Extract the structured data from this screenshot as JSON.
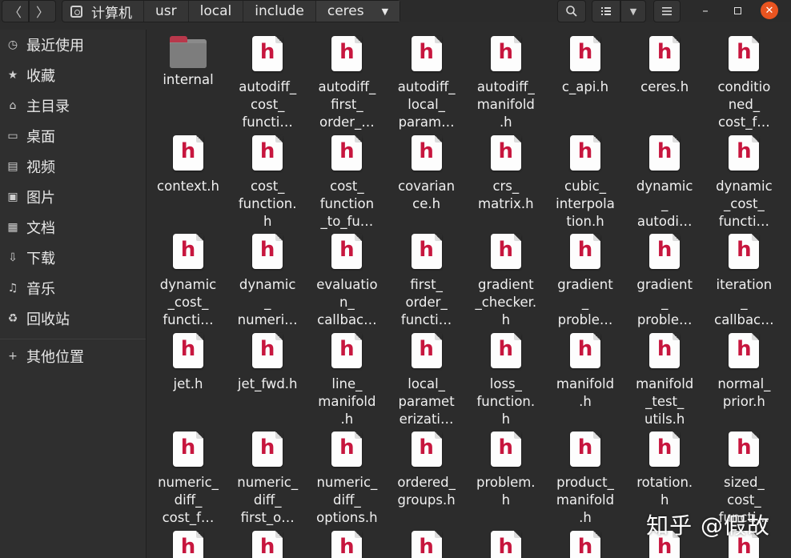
{
  "breadcrumbs": [
    "计算机",
    "usr",
    "local",
    "include",
    "ceres"
  ],
  "sidebar": {
    "items": [
      {
        "label": "最近使用",
        "icon": "clock-icon",
        "glyph": "◷"
      },
      {
        "label": "收藏",
        "icon": "star-icon",
        "glyph": "★"
      },
      {
        "label": "主目录",
        "icon": "home-icon",
        "glyph": "⌂"
      },
      {
        "label": "桌面",
        "icon": "desktop-icon",
        "glyph": "▭"
      },
      {
        "label": "视频",
        "icon": "video-icon",
        "glyph": "▤"
      },
      {
        "label": "图片",
        "icon": "image-icon",
        "glyph": "▣"
      },
      {
        "label": "文档",
        "icon": "document-icon",
        "glyph": "▦"
      },
      {
        "label": "下载",
        "icon": "download-icon",
        "glyph": "⇩"
      },
      {
        "label": "音乐",
        "icon": "music-icon",
        "glyph": "♫"
      },
      {
        "label": "回收站",
        "icon": "trash-icon",
        "glyph": "♻"
      }
    ],
    "other_locations": {
      "label": "其他位置",
      "icon": "plus-icon",
      "glyph": "+"
    }
  },
  "files": [
    {
      "name": "internal",
      "type": "folder"
    },
    {
      "name": "autodiff_\ncost_\nfuncti…",
      "type": "header"
    },
    {
      "name": "autodiff_\nfirst_\norder_…",
      "type": "header"
    },
    {
      "name": "autodiff_\nlocal_\nparam…",
      "type": "header"
    },
    {
      "name": "autodiff_\nmanifold\n.h",
      "type": "header"
    },
    {
      "name": "c_api.h",
      "type": "header"
    },
    {
      "name": "ceres.h",
      "type": "header"
    },
    {
      "name": "conditio\nned_\ncost_f…",
      "type": "header"
    },
    {
      "name": "context.h",
      "type": "header"
    },
    {
      "name": "cost_\nfunction.\nh",
      "type": "header"
    },
    {
      "name": "cost_\nfunction\n_to_fu…",
      "type": "header"
    },
    {
      "name": "covarian\nce.h",
      "type": "header"
    },
    {
      "name": "crs_\nmatrix.h",
      "type": "header"
    },
    {
      "name": "cubic_\ninterpola\ntion.h",
      "type": "header"
    },
    {
      "name": "dynamic\n_\nautodi…",
      "type": "header"
    },
    {
      "name": "dynamic\n_cost_\nfuncti…",
      "type": "header"
    },
    {
      "name": "dynamic\n_cost_\nfuncti…",
      "type": "header"
    },
    {
      "name": "dynamic\n_\nnumeri…",
      "type": "header"
    },
    {
      "name": "evaluatio\nn_\ncallbac…",
      "type": "header"
    },
    {
      "name": "first_\norder_\nfuncti…",
      "type": "header"
    },
    {
      "name": "gradient\n_checker.\nh",
      "type": "header"
    },
    {
      "name": "gradient\n_\nproble…",
      "type": "header"
    },
    {
      "name": "gradient\n_\nproble…",
      "type": "header"
    },
    {
      "name": "iteration\n_\ncallbac…",
      "type": "header"
    },
    {
      "name": "jet.h",
      "type": "header"
    },
    {
      "name": "jet_fwd.h",
      "type": "header"
    },
    {
      "name": "line_\nmanifold\n.h",
      "type": "header"
    },
    {
      "name": "local_\nparamet\nerizati…",
      "type": "header"
    },
    {
      "name": "loss_\nfunction.\nh",
      "type": "header"
    },
    {
      "name": "manifold\n.h",
      "type": "header"
    },
    {
      "name": "manifold\n_test_\nutils.h",
      "type": "header"
    },
    {
      "name": "normal_\nprior.h",
      "type": "header"
    },
    {
      "name": "numeric_\ndiff_\ncost_f…",
      "type": "header"
    },
    {
      "name": "numeric_\ndiff_\nfirst_o…",
      "type": "header"
    },
    {
      "name": "numeric_\ndiff_\noptions.h",
      "type": "header"
    },
    {
      "name": "ordered_\ngroups.h",
      "type": "header"
    },
    {
      "name": "problem.\nh",
      "type": "header"
    },
    {
      "name": "product_\nmanifold\n.h",
      "type": "header"
    },
    {
      "name": "rotation.\nh",
      "type": "header"
    },
    {
      "name": "sized_\ncost_\nfuncti…",
      "type": "header"
    },
    {
      "name": "",
      "type": "header"
    },
    {
      "name": "",
      "type": "header"
    },
    {
      "name": "",
      "type": "header"
    },
    {
      "name": "",
      "type": "header"
    },
    {
      "name": "",
      "type": "header"
    },
    {
      "name": "",
      "type": "header"
    },
    {
      "name": "",
      "type": "header"
    },
    {
      "name": "",
      "type": "header"
    }
  ],
  "header_icon_letter": "h",
  "watermark": "知乎 @假故",
  "colors": {
    "accent_close": "#e95420",
    "header_file_icon": "#c7163e"
  }
}
